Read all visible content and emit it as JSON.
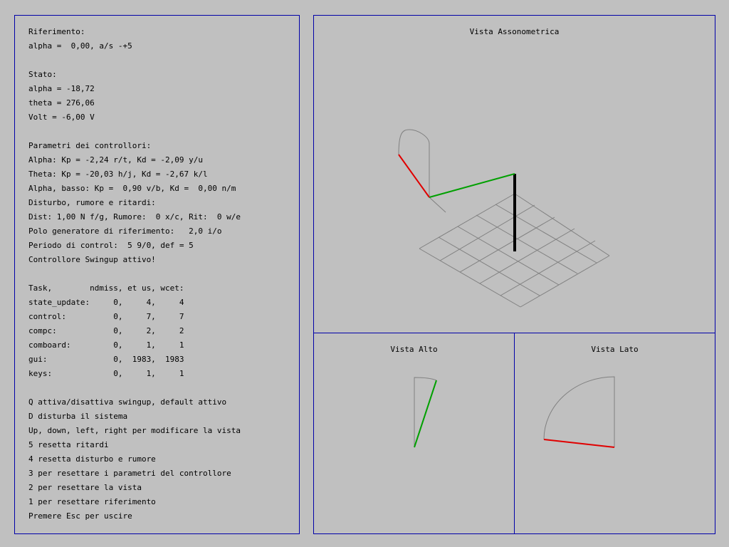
{
  "info": {
    "lines": [
      "Riferimento:",
      "alpha =  0,00, a/s -+5",
      "",
      "Stato:",
      "alpha = -18,72",
      "theta = 276,06",
      "Volt = -6,00 V",
      "",
      "Parametri dei controllori:",
      "Alpha: Kp = -2,24 r/t, Kd = -2,09 y/u",
      "Theta: Kp = -20,03 h/j, Kd = -2,67 k/l",
      "Alpha, basso: Kp =  0,90 v/b, Kd =  0,00 n/m",
      "Disturbo, rumore e ritardi:",
      "Dist: 1,00 N f/g, Rumore:  0 x/c, Rit:  0 w/e",
      "Polo generatore di riferimento:   2,0 i/o",
      "Periodo di control:  5 9/0, def = 5",
      "Controllore Swingup attivo!",
      "",
      "Task,        ndmiss, et us, wcet:",
      "state_update:     0,     4,     4",
      "control:          0,     7,     7",
      "compc:            0,     2,     2",
      "comboard:         0,     1,     1",
      "gui:              0,  1983,  1983",
      "keys:             0,     1,     1",
      "",
      "Q attiva/disattiva swingup, default attivo",
      "D disturba il sistema",
      "Up, down, left, right per modificare la vista",
      "5 resetta ritardi",
      "4 resetta disturbo e rumore",
      "3 per resettare i parametri del controllore",
      "2 per resettare la vista",
      "1 per resettare riferimento",
      "Premere Esc per uscire"
    ]
  },
  "views": {
    "iso_title": "Vista Assonometrica",
    "top_title": "Vista Alto",
    "side_title": "Vista Lato"
  },
  "colors": {
    "background": "#c0c0c0",
    "border": "#0000a8",
    "grid": "#808080",
    "arm": "#00a000",
    "pendulum": "#e00000",
    "post": "#000000"
  }
}
